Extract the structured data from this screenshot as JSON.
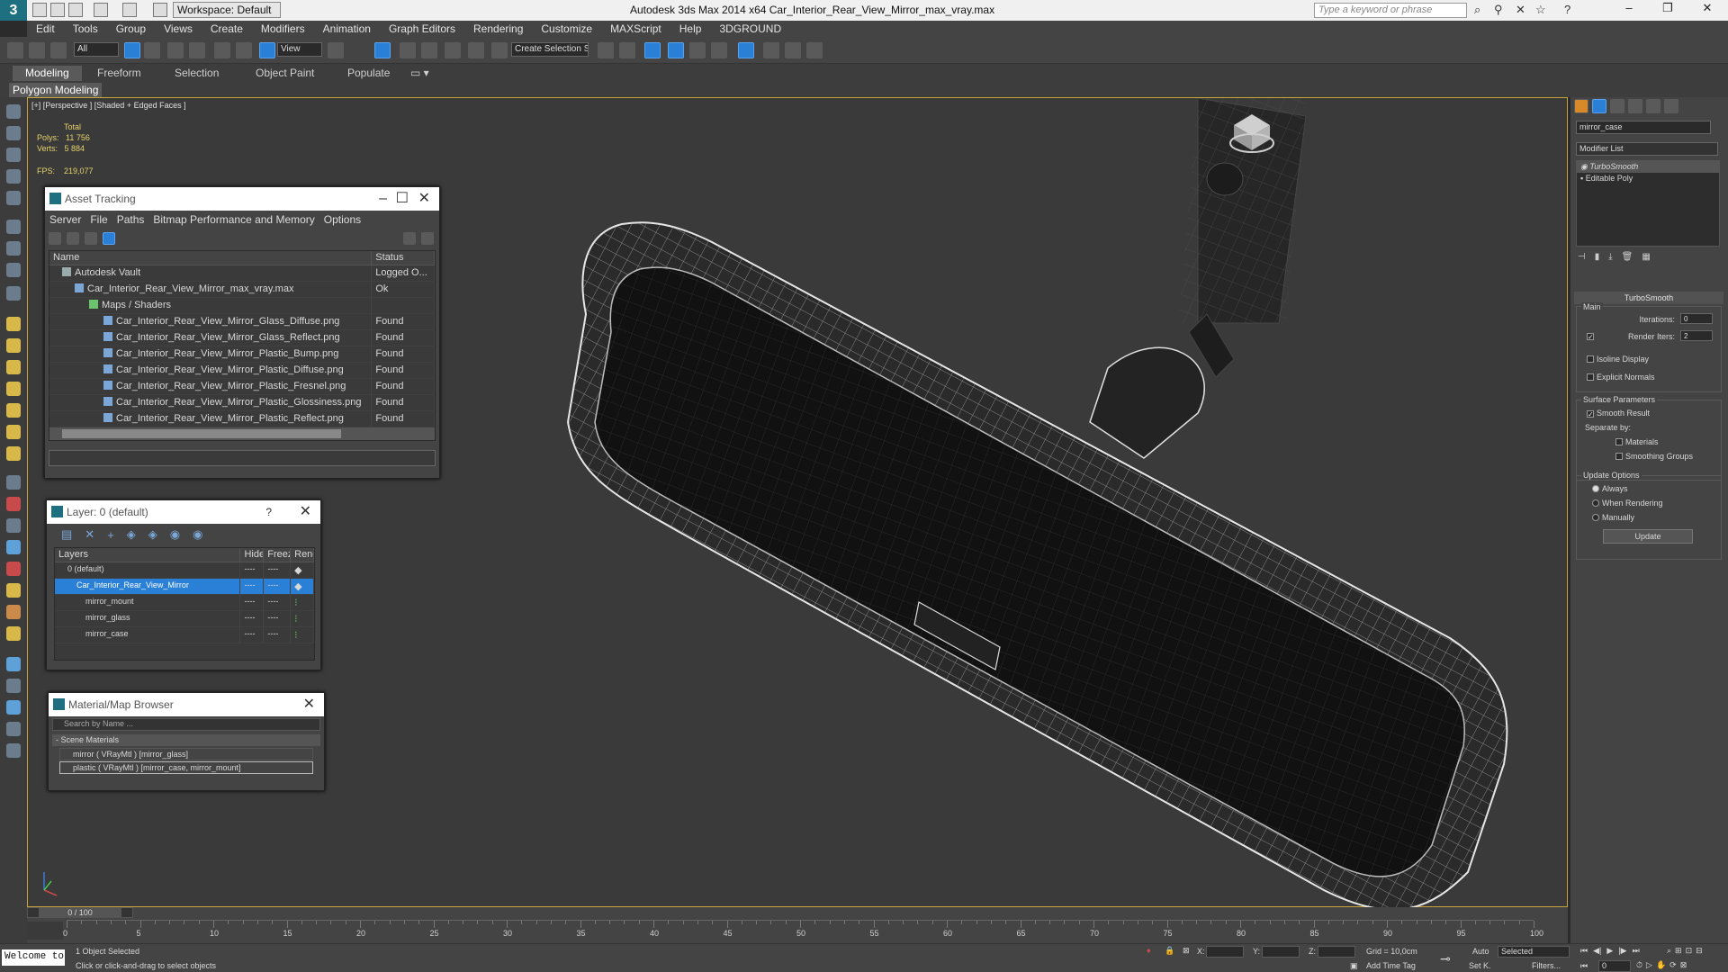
{
  "window": {
    "title": "Autodesk 3ds Max  2014 x64     Car_Interior_Rear_View_Mirror_max_vray.max",
    "workspace": "Workspace: Default",
    "search_placeholder": "Type a keyword or phrase"
  },
  "menu": [
    "Edit",
    "Tools",
    "Group",
    "Views",
    "Create",
    "Modifiers",
    "Animation",
    "Graph Editors",
    "Rendering",
    "Customize",
    "MAXScript",
    "Help",
    "3DGROUND"
  ],
  "toolbar": {
    "filter": "All",
    "ref_coord": "View",
    "selection_set": "Create Selection Se"
  },
  "ribbon": {
    "tabs": [
      "Modeling",
      "Freeform",
      "Selection",
      "Object Paint",
      "Populate"
    ],
    "sub_label": "Polygon Modeling"
  },
  "viewport": {
    "label": "[+] [Perspective ] [Shaded + Edged Faces ]",
    "stats": {
      "total_label": "Total",
      "polys_label": "Polys:",
      "polys": "11 756",
      "verts_label": "Verts:",
      "verts": "5 884",
      "fps_label": "FPS:",
      "fps": "219,077"
    }
  },
  "asset_tracking": {
    "title": "Asset Tracking",
    "menu": [
      "Server",
      "File",
      "Paths",
      "Bitmap Performance and Memory",
      "Options"
    ],
    "columns": [
      "Name",
      "Status"
    ],
    "rows": [
      {
        "name": "Autodesk Vault",
        "status": "Logged O..."
      },
      {
        "name": "Car_Interior_Rear_View_Mirror_max_vray.max",
        "status": "Ok"
      },
      {
        "name": "Maps / Shaders",
        "status": ""
      },
      {
        "name": "Car_Interior_Rear_View_Mirror_Glass_Diffuse.png",
        "status": "Found"
      },
      {
        "name": "Car_Interior_Rear_View_Mirror_Glass_Reflect.png",
        "status": "Found"
      },
      {
        "name": "Car_Interior_Rear_View_Mirror_Plastic_Bump.png",
        "status": "Found"
      },
      {
        "name": "Car_Interior_Rear_View_Mirror_Plastic_Diffuse.png",
        "status": "Found"
      },
      {
        "name": "Car_Interior_Rear_View_Mirror_Plastic_Fresnel.png",
        "status": "Found"
      },
      {
        "name": "Car_Interior_Rear_View_Mirror_Plastic_Glossiness.png",
        "status": "Found"
      },
      {
        "name": "Car_Interior_Rear_View_Mirror_Plastic_Reflect.png",
        "status": "Found"
      }
    ]
  },
  "layer": {
    "title": "Layer: 0 (default)",
    "help": "?",
    "columns": [
      "Layers",
      "Hide",
      "Freeze",
      "Rende"
    ],
    "rows": [
      {
        "name": "0 (default)",
        "dash": "----"
      },
      {
        "name": "Car_Interior_Rear_View_Mirror",
        "dash": "----"
      },
      {
        "name": "mirror_mount",
        "dash": "----"
      },
      {
        "name": "mirror_glass",
        "dash": "----"
      },
      {
        "name": "mirror_case",
        "dash": "----"
      }
    ]
  },
  "material_browser": {
    "title": "Material/Map Browser",
    "search_placeholder": "Search by Name ...",
    "group": "- Scene Materials",
    "items": [
      "mirror  ( VRayMtl ) [mirror_glass]",
      "plastic  ( VRayMtl ) [mirror_case, mirror_mount]"
    ]
  },
  "command_panel": {
    "object_name": "mirror_case",
    "modifier_list": "Modifier List",
    "stack": [
      "TurboSmooth",
      "Editable Poly"
    ],
    "rollout": "TurboSmooth",
    "main": "Main",
    "iterations_label": "Iterations:",
    "iterations": "0",
    "render_iters_label": "Render Iters:",
    "render_iters": "2",
    "isoline": "Isoline Display",
    "explicit": "Explicit Normals",
    "surface": "Surface Parameters",
    "smooth_result": "Smooth Result",
    "separate_by": "Separate by:",
    "materials": "Materials",
    "smoothing_groups": "Smoothing Groups",
    "update_options": "Update Options",
    "always": "Always",
    "when_rendering": "When Rendering",
    "manually": "Manually",
    "update": "Update"
  },
  "timeline": {
    "frame": "0 / 100",
    "ticks": [
      "0",
      "5",
      "10",
      "15",
      "20",
      "25",
      "30",
      "35",
      "40",
      "45",
      "50",
      "55",
      "60",
      "65",
      "70",
      "75",
      "80",
      "85",
      "90",
      "95",
      "100"
    ]
  },
  "status": {
    "listener": "Welcome to",
    "selected": "1 Object Selected",
    "prompt": "Click or click-and-drag to select objects",
    "x_label": "X:",
    "y_label": "Y:",
    "z_label": "Z:",
    "grid": "Grid = 10,0cm",
    "add_time_tag": "Add Time Tag",
    "auto": "Auto",
    "set_key": "Set K.",
    "selected_dd": "Selected",
    "filters": "Filters...",
    "frame_field": "0"
  }
}
